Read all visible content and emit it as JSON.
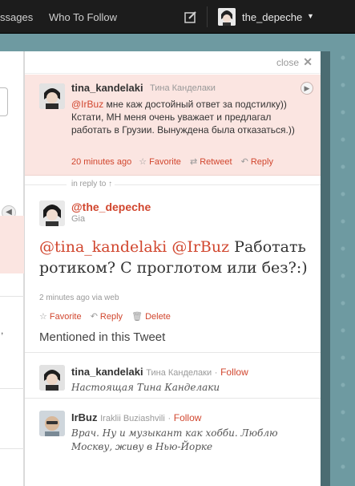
{
  "topbar": {
    "messages": "ssages",
    "who_to_follow": "Who To Follow",
    "username": "the_depeche"
  },
  "panel": {
    "close": "close"
  },
  "original_tweet": {
    "username": "tina_kandelaki",
    "fullname": "Тина Канделаки",
    "mention": "@IrBuz",
    "text": " мне каж достойный ответ за подстилку)) Кстати, МН меня очень уважает и предлагал работать в Грузии. Вынуждена была отказаться.))",
    "time": "20 minutes ago",
    "favorite": "Favorite",
    "retweet": "Retweet",
    "reply": "Reply"
  },
  "in_reply_to": "in reply to ↑",
  "main_tweet": {
    "username": "@the_depeche",
    "fullname": "Gia",
    "mention1": "@tina_kandelaki",
    "mention2": "@IrBuz",
    "text": " Работать ротиком? С проглотом или без?:)",
    "time": "2 minutes ago via web",
    "favorite": "Favorite",
    "reply": "Reply",
    "delete": "Delete"
  },
  "mentioned": {
    "heading": "Mentioned in this Tweet",
    "users": [
      {
        "username": "tina_kandelaki",
        "fullname": "Тина Канделаки",
        "follow": "Follow",
        "bio": "Настоящая Тина Канделаки"
      },
      {
        "username": "IrBuz",
        "fullname": "Iraklii Buziashvili",
        "follow": "Follow",
        "bio": "Врач. Ну и музыкант как хобби. Люблю Москву, живу в Нью-Йорке"
      }
    ]
  },
  "colors": {
    "accent": "#d1462e",
    "highlight": "#fbe5e1",
    "topbar": "#1c1c1c",
    "background": "#6e9aa1"
  }
}
